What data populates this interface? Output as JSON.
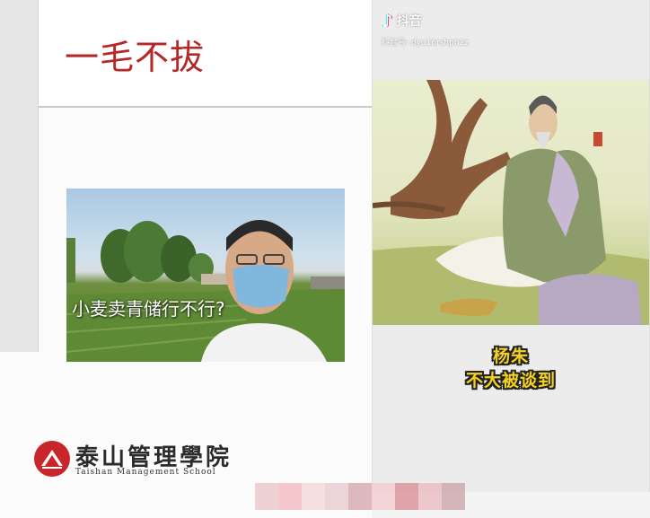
{
  "slide": {
    "title": "一毛不拔",
    "video_caption": "小麦卖青储行不行?",
    "logo": {
      "name_cn": "泰山管理學院",
      "name_en": "Taishan  Management  School"
    }
  },
  "phone": {
    "app_name": "抖音",
    "account_id": "抖音号: dyu16rshph2z",
    "subtitles": [
      "杨朱",
      "不大被谈到"
    ]
  },
  "colors": {
    "title_red": "#b5282a",
    "seal_red": "#c8262b",
    "subtitle_yellow": "#f4d21f",
    "blur_blocks": [
      "#e8c3c6",
      "#f0b5bb",
      "#f4d5d7",
      "#e6c8cc",
      "#d3a2a8",
      "#f3c9cd",
      "#d88a90",
      "#eab8bd",
      "#c9a0a5"
    ]
  },
  "icons": {
    "tiktok": "tiktok-note-icon",
    "seal": "school-seal-icon"
  }
}
